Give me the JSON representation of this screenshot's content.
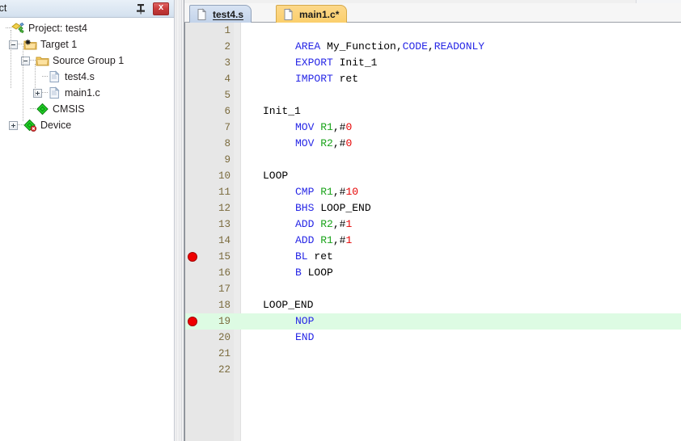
{
  "project_panel": {
    "title": "oject",
    "full_title": "Project",
    "pin_icon": "pin-icon",
    "close_icon": "close-icon",
    "close_label": "x",
    "tree": [
      {
        "label": "Project: test4",
        "indent": 0,
        "expander": "none",
        "icon": "project-icon",
        "icon_type": "project"
      },
      {
        "label": "Target 1",
        "indent": 1,
        "expander": "minus",
        "icon": "target-folder-icon",
        "icon_type": "target"
      },
      {
        "label": "Source Group 1",
        "indent": 2,
        "expander": "minus",
        "icon": "folder-icon",
        "icon_type": "folder"
      },
      {
        "label": "test4.s",
        "indent": 3,
        "expander": "none",
        "icon": "file-icon",
        "icon_type": "file"
      },
      {
        "label": "main1.c",
        "indent": 3,
        "expander": "plus",
        "icon": "file-icon",
        "icon_type": "file"
      },
      {
        "label": "CMSIS",
        "indent": 2,
        "expander": "none",
        "icon": "cmsis-icon",
        "icon_type": "diamond"
      },
      {
        "label": "Device",
        "indent": 1,
        "expander": "plus",
        "icon": "device-icon",
        "icon_type": "diamond-error"
      }
    ]
  },
  "editor": {
    "tabs": [
      {
        "label": "test4.s",
        "active": true,
        "dirty": false,
        "icon": "document-icon"
      },
      {
        "label": "main1.c*",
        "active": false,
        "dirty": true,
        "icon": "document-icon"
      }
    ],
    "colors": {
      "keyword": "#2727e6",
      "register": "#19a319",
      "immediate": "#e60000",
      "plain": "#000000",
      "current_line_highlight": "#ddfbe3",
      "breakpoint": "#ef0000",
      "line_number": "#7a6a3c",
      "gutter": "#e7e7e7"
    },
    "current_line": 19,
    "breakpoint_lines": [
      15,
      19
    ],
    "lines": [
      {
        "n": 1,
        "indent": false,
        "breakpoint": false,
        "highlight": false,
        "tokens": []
      },
      {
        "n": 2,
        "indent": true,
        "breakpoint": false,
        "highlight": false,
        "tokens": [
          {
            "t": "AREA",
            "c": "kw"
          },
          {
            "t": " ",
            "c": "pun"
          },
          {
            "t": "My_Function",
            "c": "pun"
          },
          {
            "t": ",",
            "c": "pun"
          },
          {
            "t": "CODE",
            "c": "kw"
          },
          {
            "t": ",",
            "c": "pun"
          },
          {
            "t": "READONLY",
            "c": "kw"
          }
        ]
      },
      {
        "n": 3,
        "indent": true,
        "breakpoint": false,
        "highlight": false,
        "tokens": [
          {
            "t": "EXPORT",
            "c": "kw"
          },
          {
            "t": " Init_1",
            "c": "pun"
          }
        ]
      },
      {
        "n": 4,
        "indent": true,
        "breakpoint": false,
        "highlight": false,
        "tokens": [
          {
            "t": "IMPORT",
            "c": "kw"
          },
          {
            "t": " ret",
            "c": "pun"
          }
        ]
      },
      {
        "n": 5,
        "indent": false,
        "breakpoint": false,
        "highlight": false,
        "tokens": []
      },
      {
        "n": 6,
        "indent": false,
        "breakpoint": false,
        "highlight": false,
        "tokens": [
          {
            "t": "Init_1",
            "c": "pun"
          }
        ]
      },
      {
        "n": 7,
        "indent": true,
        "breakpoint": false,
        "highlight": false,
        "tokens": [
          {
            "t": "MOV",
            "c": "kw"
          },
          {
            "t": " ",
            "c": "pun"
          },
          {
            "t": "R1",
            "c": "reg"
          },
          {
            "t": ",#",
            "c": "pun"
          },
          {
            "t": "0",
            "c": "num2"
          }
        ]
      },
      {
        "n": 8,
        "indent": true,
        "breakpoint": false,
        "highlight": false,
        "tokens": [
          {
            "t": "MOV",
            "c": "kw"
          },
          {
            "t": " ",
            "c": "pun"
          },
          {
            "t": "R2",
            "c": "reg"
          },
          {
            "t": ",#",
            "c": "pun"
          },
          {
            "t": "0",
            "c": "num2"
          }
        ]
      },
      {
        "n": 9,
        "indent": false,
        "breakpoint": false,
        "highlight": false,
        "tokens": []
      },
      {
        "n": 10,
        "indent": false,
        "breakpoint": false,
        "highlight": false,
        "tokens": [
          {
            "t": "LOOP",
            "c": "pun"
          }
        ]
      },
      {
        "n": 11,
        "indent": true,
        "breakpoint": false,
        "highlight": false,
        "tokens": [
          {
            "t": "CMP",
            "c": "kw"
          },
          {
            "t": " ",
            "c": "pun"
          },
          {
            "t": "R1",
            "c": "reg"
          },
          {
            "t": ",#",
            "c": "pun"
          },
          {
            "t": "10",
            "c": "num2"
          }
        ]
      },
      {
        "n": 12,
        "indent": true,
        "breakpoint": false,
        "highlight": false,
        "tokens": [
          {
            "t": "BHS",
            "c": "kw"
          },
          {
            "t": " LOOP_END",
            "c": "pun"
          }
        ]
      },
      {
        "n": 13,
        "indent": true,
        "breakpoint": false,
        "highlight": false,
        "tokens": [
          {
            "t": "ADD",
            "c": "kw"
          },
          {
            "t": " ",
            "c": "pun"
          },
          {
            "t": "R2",
            "c": "reg"
          },
          {
            "t": ",#",
            "c": "pun"
          },
          {
            "t": "1",
            "c": "num2"
          }
        ]
      },
      {
        "n": 14,
        "indent": true,
        "breakpoint": false,
        "highlight": false,
        "tokens": [
          {
            "t": "ADD",
            "c": "kw"
          },
          {
            "t": " ",
            "c": "pun"
          },
          {
            "t": "R1",
            "c": "reg"
          },
          {
            "t": ",#",
            "c": "pun"
          },
          {
            "t": "1",
            "c": "num2"
          }
        ]
      },
      {
        "n": 15,
        "indent": true,
        "breakpoint": true,
        "highlight": false,
        "tokens": [
          {
            "t": "BL",
            "c": "kw"
          },
          {
            "t": " ret",
            "c": "pun"
          }
        ]
      },
      {
        "n": 16,
        "indent": true,
        "breakpoint": false,
        "highlight": false,
        "tokens": [
          {
            "t": "B",
            "c": "kw"
          },
          {
            "t": " LOOP",
            "c": "pun"
          }
        ]
      },
      {
        "n": 17,
        "indent": false,
        "breakpoint": false,
        "highlight": false,
        "tokens": []
      },
      {
        "n": 18,
        "indent": false,
        "breakpoint": false,
        "highlight": false,
        "tokens": [
          {
            "t": "LOOP_END",
            "c": "pun"
          }
        ]
      },
      {
        "n": 19,
        "indent": true,
        "breakpoint": true,
        "highlight": true,
        "tokens": [
          {
            "t": "NOP",
            "c": "kw"
          }
        ]
      },
      {
        "n": 20,
        "indent": true,
        "breakpoint": false,
        "highlight": false,
        "tokens": [
          {
            "t": "END",
            "c": "kw"
          }
        ]
      },
      {
        "n": 21,
        "indent": false,
        "breakpoint": false,
        "highlight": false,
        "tokens": []
      },
      {
        "n": 22,
        "indent": false,
        "breakpoint": false,
        "highlight": false,
        "tokens": []
      }
    ]
  }
}
